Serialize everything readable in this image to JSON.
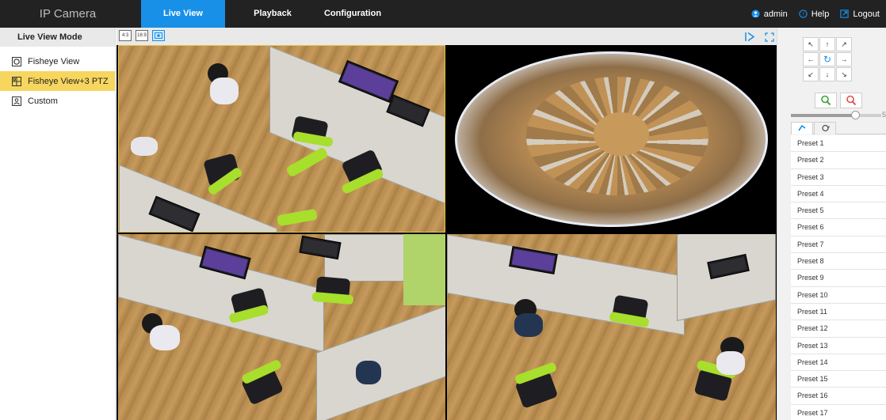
{
  "header": {
    "brand": "IP Camera",
    "tabs": [
      {
        "label": "Live View",
        "active": true
      },
      {
        "label": "Playback",
        "active": false
      },
      {
        "label": "Configuration",
        "active": false
      }
    ],
    "user": "admin",
    "help": "Help",
    "logout": "Logout",
    "accent_color": "#1890e8"
  },
  "left_panel": {
    "title": "Live View Mode",
    "modes": [
      {
        "label": "Fisheye View",
        "icon": "fisheye-icon",
        "selected": false
      },
      {
        "label": "Fisheye View+3 PTZ",
        "icon": "grid-icon",
        "selected": true
      },
      {
        "label": "Custom",
        "icon": "custom-icon",
        "selected": false
      }
    ],
    "selected_color": "#f7d65f"
  },
  "toolbar": {
    "layout_buttons": [
      {
        "label": "4:3",
        "icon": "aspect-4-3-icon"
      },
      {
        "label": "16:9",
        "icon": "aspect-16-9-icon"
      },
      {
        "label": "",
        "icon": "auto-fit-icon"
      }
    ],
    "play_icon": "play-icon",
    "fullscreen_icon": "fullscreen-icon"
  },
  "video_cells": [
    {
      "name": "ptz-view-1",
      "selected": true
    },
    {
      "name": "fisheye-view",
      "selected": false
    },
    {
      "name": "ptz-view-2",
      "selected": false
    },
    {
      "name": "ptz-view-3",
      "selected": false
    }
  ],
  "ptz": {
    "arrows": [
      "↖",
      "↑",
      "↗",
      "←",
      "↻",
      "→",
      "↙",
      "↓",
      "↘"
    ],
    "speed_value": "5",
    "speed_fraction": 0.71
  },
  "presets": [
    "Preset 1",
    "Preset 2",
    "Preset 3",
    "Preset 4",
    "Preset 5",
    "Preset 6",
    "Preset 7",
    "Preset 8",
    "Preset 9",
    "Preset 10",
    "Preset 11",
    "Preset 12",
    "Preset 13",
    "Preset 14",
    "Preset 15",
    "Preset 16",
    "Preset 17"
  ]
}
